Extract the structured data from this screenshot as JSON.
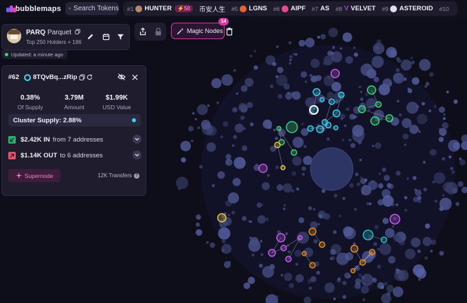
{
  "app": {
    "logo_text": "bubblemaps",
    "brand_colors": [
      "#6f5cf0",
      "#b94ce8",
      "#e84aa1"
    ]
  },
  "search": {
    "placeholder": "Search Tokens"
  },
  "top_tokens": [
    {
      "rank": "#1",
      "name": "HUNTER",
      "badge": "50",
      "color": "#b08a6a"
    },
    {
      "rank": "",
      "name": "币安人生",
      "badge": "",
      "color": ""
    },
    {
      "rank": "#5",
      "name": "LGNS",
      "badge": "",
      "color": "#e8622c"
    },
    {
      "rank": "#6",
      "name": "AIPF",
      "badge": "",
      "color": "#e84a8a"
    },
    {
      "rank": "#7",
      "name": "AS",
      "badge": "",
      "color": "#f0a020"
    },
    {
      "rank": "#8",
      "name": "VELVET",
      "badge": "",
      "color": "#8a4ad8"
    },
    {
      "rank": "#9",
      "name": "ASTEROID",
      "badge": "",
      "color": "#dfe0ec"
    },
    {
      "rank": "#10",
      "name": "",
      "badge": "",
      "color": ""
    }
  ],
  "token_card": {
    "symbol": "PARQ",
    "name": "Parquet",
    "holders": "Top 250 Holders + 186",
    "updated": "Updated: a minute ago"
  },
  "toolbar": {
    "magic_nodes_label": "Magic Nodes",
    "magic_nodes_count": "14"
  },
  "holder": {
    "rank": "#62",
    "address": "8TQvBq...zRip",
    "supply_pct": "0.38%",
    "supply_label": "Of Supply",
    "amount": "3.79M",
    "amount_label": "Amount",
    "usd": "$1.99K",
    "usd_label": "USD Value",
    "cluster_supply": "Cluster Supply: 2.88%",
    "in_amount": "$2.42K IN",
    "in_desc": "from 7 addresses",
    "out_amount": "$1.14K OUT",
    "out_desc": "to 6 addresses",
    "supernode_label": "Supernode",
    "transfers": "12K Transfers"
  },
  "colors": {
    "background": "#0e0d1a",
    "panel": "#1f1d2d",
    "accent_pink": "#d23b9d",
    "in_green": "#2faa6a",
    "out_red": "#e0546a",
    "cluster_teal": "#3ec9e6",
    "bubble_default": "#3a3f6e"
  },
  "icons": [
    "search-icon",
    "copy-icon",
    "pencil-icon",
    "calendar-icon",
    "filter-icon",
    "share-icon",
    "lock-icon",
    "magic-wand-icon",
    "trash-icon",
    "refresh-icon",
    "eye-off-icon",
    "close-icon",
    "chevron-down-icon",
    "info-icon"
  ]
}
